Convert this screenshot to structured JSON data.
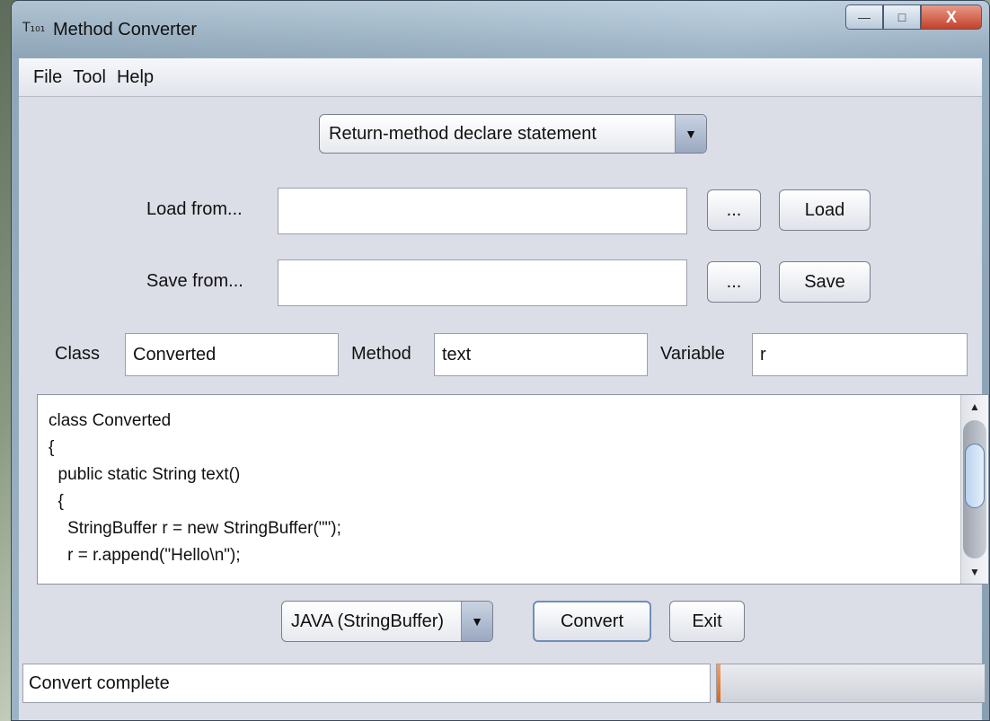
{
  "window": {
    "title": "Method Converter",
    "app_icon": "T₁₀₁",
    "controls": {
      "minimize_icon": "—",
      "maximize_icon": "□",
      "close_icon": "X"
    }
  },
  "menu": [
    "File",
    "Tool",
    "Help"
  ],
  "mode_select": {
    "selected": "Return-method declare statement",
    "arrow": "▼"
  },
  "load": {
    "label": "Load from...",
    "value": "",
    "browse_label": "...",
    "action_label": "Load"
  },
  "save": {
    "label": "Save from...",
    "value": "",
    "browse_label": "...",
    "action_label": "Save"
  },
  "fields": {
    "class_label": "Class",
    "class_value": "Converted",
    "method_label": "Method",
    "method_value": "text",
    "variable_label": "Variable",
    "variable_value": "r"
  },
  "code_output": "class Converted\n{\n  public static String text()\n  {\n    StringBuffer r = new StringBuffer(\"\");\n    r = r.append(\"Hello\\n\");",
  "scrollbar": {
    "up_icon": "▲",
    "down_icon": "▼",
    "thumb_position": 0.3
  },
  "bottom": {
    "language_selected": "JAVA (StringBuffer)",
    "language_arrow": "▼",
    "convert_label": "Convert",
    "exit_label": "Exit"
  },
  "status": {
    "text": "Convert complete",
    "progress": 0.01
  },
  "colors": {
    "progress_accent": "#e07020",
    "focus_border": "#6f8fb8"
  }
}
